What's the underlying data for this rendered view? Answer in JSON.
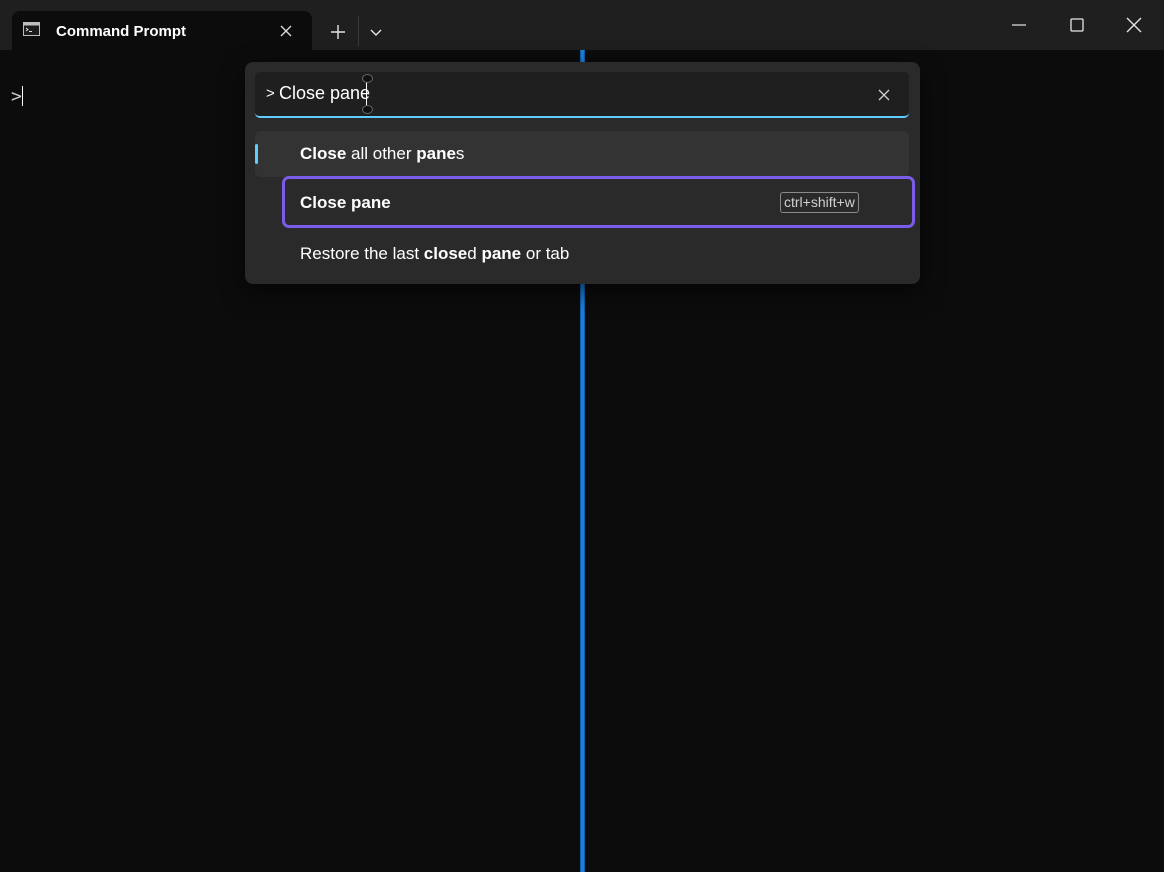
{
  "tab": {
    "title": "Command Prompt",
    "icon": "console-icon"
  },
  "titlebar": {
    "new_tab_icon": "plus-icon",
    "dropdown_icon": "chevron-down-icon",
    "minimize_icon": "minimize-icon",
    "maximize_icon": "maximize-icon",
    "close_icon": "close-icon"
  },
  "terminal": {
    "prompt": ">"
  },
  "palette": {
    "prefix": ">",
    "search_value": "Close pane",
    "items": [
      {
        "segments": [
          {
            "text": "Close",
            "bold": true
          },
          {
            "text": " all other ",
            "bold": false
          },
          {
            "text": "pane",
            "bold": true
          },
          {
            "text": "s",
            "bold": false
          }
        ]
      },
      {
        "segments": [
          {
            "text": "Close",
            "bold": true
          },
          {
            "text": " ",
            "bold": false
          },
          {
            "text": "pane",
            "bold": true
          }
        ],
        "keychord": "ctrl+shift+w"
      },
      {
        "segments": [
          {
            "text": "Restore the last ",
            "bold": false
          },
          {
            "text": "close",
            "bold": true
          },
          {
            "text": "d ",
            "bold": false
          },
          {
            "text": "pane",
            "bold": true
          },
          {
            "text": " or tab",
            "bold": false
          }
        ]
      }
    ]
  },
  "colors": {
    "accent": "#60cdff",
    "selection_outline": "#7b5ce8",
    "pane_divider": "#1a7fe0",
    "background": "#0c0c0c"
  }
}
